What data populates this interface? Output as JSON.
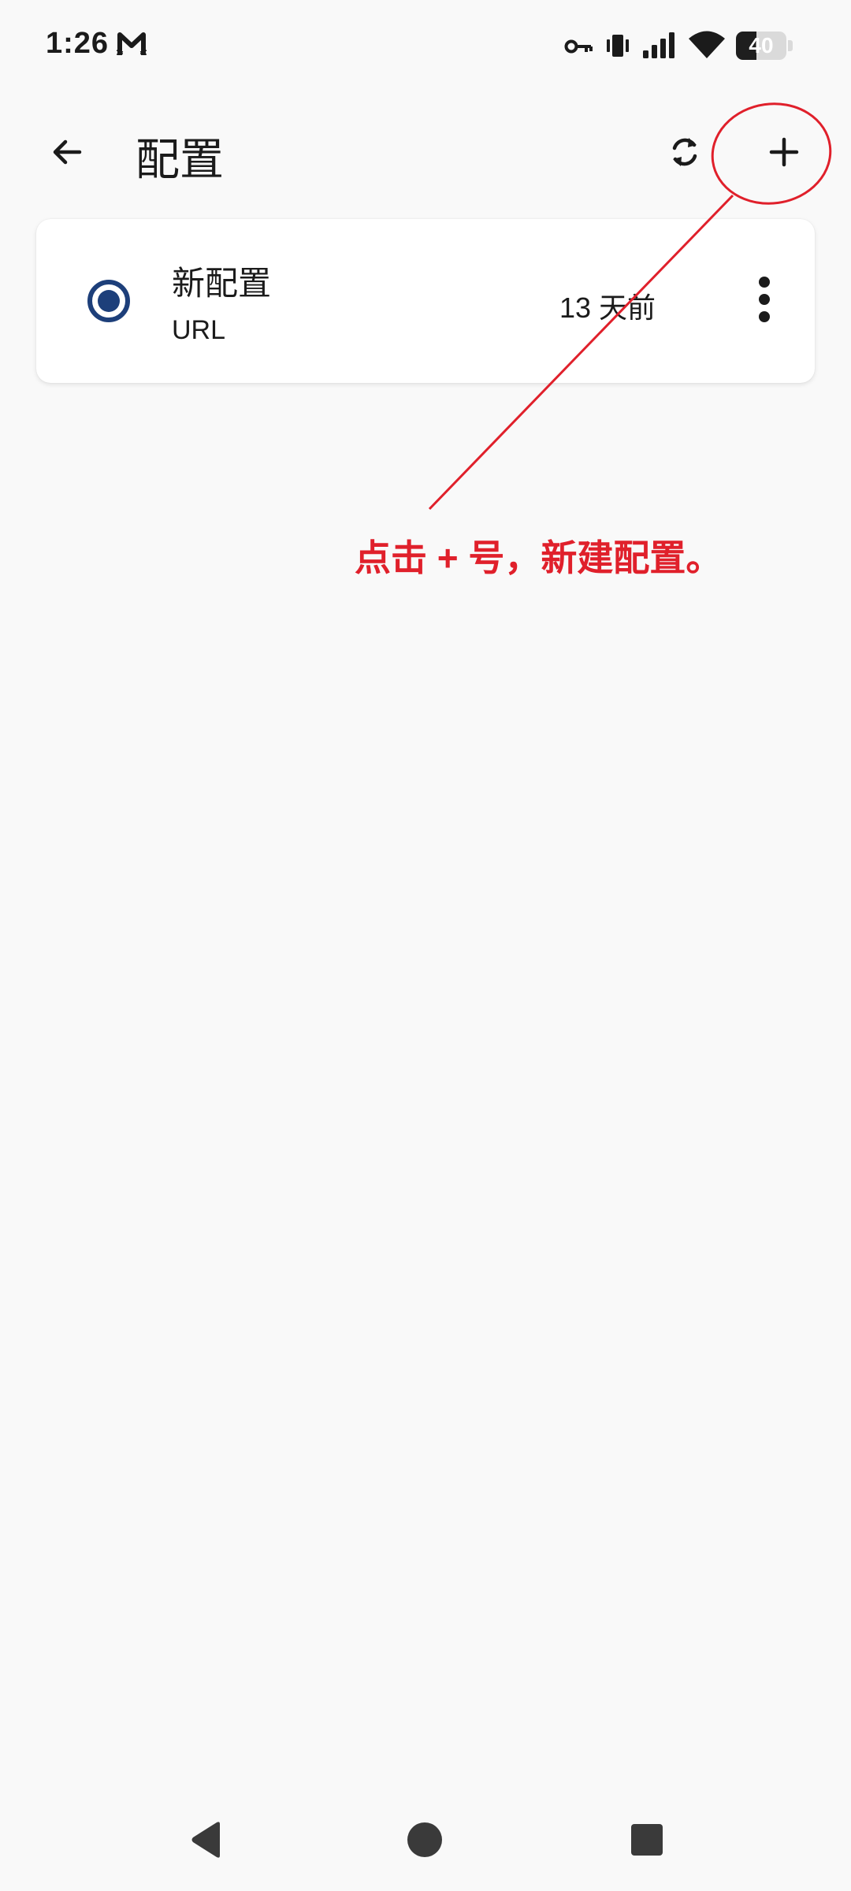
{
  "status_bar": {
    "time": "1:26",
    "battery_level": "40",
    "battery_fraction": 0.4,
    "icons": [
      "cat-m-notification-icon",
      "vpn-key-icon",
      "vibrate-icon",
      "cell-signal-icon",
      "wifi-icon",
      "battery-icon"
    ]
  },
  "app_bar": {
    "title": "配置",
    "back_icon": "arrow-back-icon",
    "refresh_icon": "sync-icon",
    "add_icon": "plus-icon"
  },
  "profiles": [
    {
      "name": "新配置",
      "type": "URL",
      "updated": "13 天前",
      "selected": true
    }
  ],
  "annotation": {
    "text": "点击 + 号，新建配置。",
    "color": "#e0202b"
  },
  "nav_bar": {
    "icons": [
      "nav-back-icon",
      "nav-home-icon",
      "nav-recents-icon"
    ]
  },
  "colors": {
    "background": "#f9f9f9",
    "card": "#ffffff",
    "radio_accent": "#1d3f7a",
    "nav_icon": "#3a3a3a"
  }
}
